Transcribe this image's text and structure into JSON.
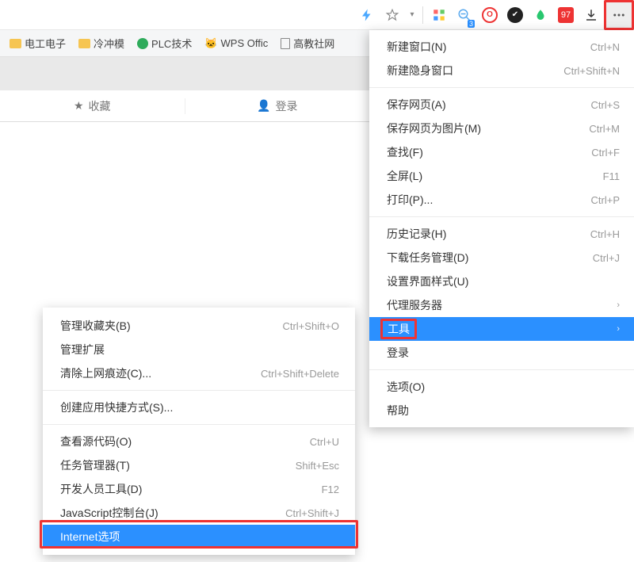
{
  "topbar": {
    "zoom_badge": "3"
  },
  "bookmarks": {
    "b1": "电工电子",
    "b2": "冷冲模",
    "b3": "PLC技术",
    "b4": "WPS Offic",
    "b5": "高教社网"
  },
  "tabbar": {
    "fav": "收藏",
    "login": "登录"
  },
  "menu": {
    "new_window": "新建窗口(N)",
    "new_window_sc": "Ctrl+N",
    "new_incog": "新建隐身窗口",
    "new_incog_sc": "Ctrl+Shift+N",
    "save_page": "保存网页(A)",
    "save_page_sc": "Ctrl+S",
    "save_img": "保存网页为图片(M)",
    "save_img_sc": "Ctrl+M",
    "find": "查找(F)",
    "find_sc": "Ctrl+F",
    "fullscreen": "全屏(L)",
    "fullscreen_sc": "F11",
    "print": "打印(P)...",
    "print_sc": "Ctrl+P",
    "history": "历史记录(H)",
    "history_sc": "Ctrl+H",
    "downloads": "下载任务管理(D)",
    "downloads_sc": "Ctrl+J",
    "skin": "设置界面样式(U)",
    "proxy": "代理服务器",
    "tools": "工具",
    "login": "登录",
    "options": "选项(O)",
    "help": "帮助"
  },
  "submenu": {
    "manage_fav": "管理收藏夹(B)",
    "manage_fav_sc": "Ctrl+Shift+O",
    "manage_ext": "管理扩展",
    "clear": "清除上网痕迹(C)...",
    "clear_sc": "Ctrl+Shift+Delete",
    "create_shortcut": "创建应用快捷方式(S)...",
    "view_src": "查看源代码(O)",
    "view_src_sc": "Ctrl+U",
    "taskmgr": "任务管理器(T)",
    "taskmgr_sc": "Shift+Esc",
    "devtools": "开发人员工具(D)",
    "devtools_sc": "F12",
    "jsconsole": "JavaScript控制台(J)",
    "jsconsole_sc": "Ctrl+Shift+J",
    "inetopt": "Internet选项"
  }
}
